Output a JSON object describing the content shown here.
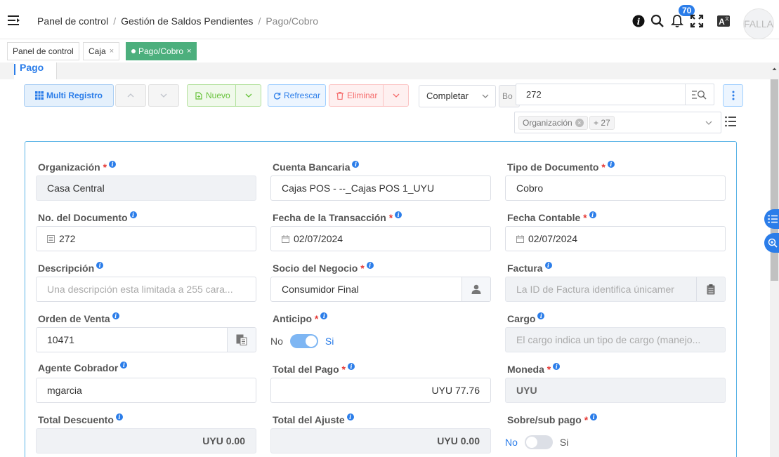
{
  "breadcrumb": {
    "items": [
      "Panel de control",
      "Gestión de Saldos Pendientes"
    ],
    "current": "Pago/Cobro",
    "sep": "/"
  },
  "header": {
    "notifications_count": "70",
    "user": "FALLA"
  },
  "tabs": [
    {
      "label": "Panel de control"
    },
    {
      "label": "Caja",
      "close": "×"
    },
    {
      "label": "Pago/Cobro",
      "close": "×"
    }
  ],
  "window_tab": "Pago",
  "toolbar": {
    "multi": "Multi Registro",
    "nuevo": "Nuevo",
    "refrescar": "Refrescar",
    "eliminar": "Eliminar",
    "action_select": "Completar",
    "bc": "Bo",
    "search_value": "272"
  },
  "filter": {
    "chip": "Organización",
    "more": "+ 27"
  },
  "toggle_labels": {
    "off": "No",
    "on": "Si"
  },
  "fields": {
    "organizacion": {
      "label": "Organización",
      "value": "Casa Central"
    },
    "cuenta_bancaria": {
      "label": "Cuenta Bancaria",
      "value": "Cajas POS - --_Cajas POS 1_UYU"
    },
    "tipo_documento": {
      "label": "Tipo de Documento",
      "value": "Cobro"
    },
    "no_documento": {
      "label": "No. del Documento",
      "value": "272"
    },
    "fecha_transaccion": {
      "label": "Fecha de la Transacción",
      "value": "02/07/2024"
    },
    "fecha_contable": {
      "label": "Fecha Contable",
      "value": "02/07/2024"
    },
    "descripcion": {
      "label": "Descripción",
      "placeholder": "Una descripción esta limitada a 255 cara..."
    },
    "socio": {
      "label": "Socio del Negocio",
      "value": "Consumidor Final"
    },
    "factura": {
      "label": "Factura",
      "placeholder": "La ID de Factura identifica únicamer"
    },
    "orden_venta": {
      "label": "Orden de Venta",
      "value": "10471"
    },
    "anticipo": {
      "label": "Anticipo",
      "checked": true
    },
    "cargo": {
      "label": "Cargo",
      "placeholder": "El cargo indica un tipo de cargo (manejo..."
    },
    "agente": {
      "label": "Agente Cobrador",
      "value": "mgarcia"
    },
    "total_pago": {
      "label": "Total del Pago",
      "value": "UYU 77.76"
    },
    "moneda": {
      "label": "Moneda",
      "value": "UYU"
    },
    "total_descuento": {
      "label": "Total Descuento",
      "value": "UYU 0.00"
    },
    "total_ajuste": {
      "label": "Total del Ajuste",
      "value": "UYU 0.00"
    },
    "sobre_sub": {
      "label": "Sobre/sub pago",
      "checked": false
    }
  },
  "colors": {
    "primary": "#2b7de9",
    "success": "#67c23a",
    "danger": "#f56c6c",
    "required": "#e53935"
  }
}
